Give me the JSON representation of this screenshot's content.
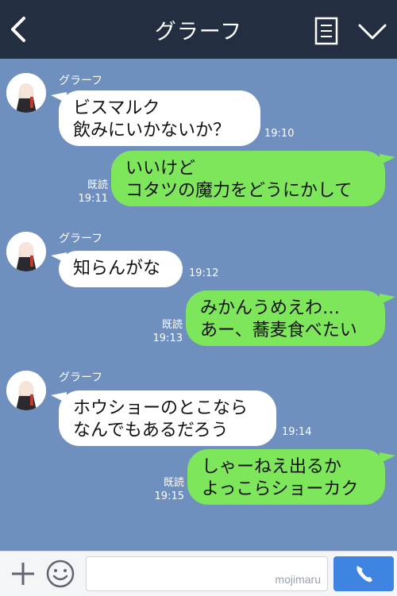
{
  "header": {
    "title": "グラーフ",
    "back_icon": "chevron-left-icon",
    "memo_icon": "note-icon",
    "menu_icon": "chevron-down-icon",
    "background": "#232f40"
  },
  "chat": {
    "background": "#6f8fbf",
    "incoming_bubble_color": "#ffffff",
    "outgoing_bubble_color": "#7ee65a",
    "messages": [
      {
        "direction": "in",
        "sender": "グラーフ",
        "lines": [
          "ビスマルク",
          "飲みにいかないか？"
        ],
        "time": "19:10"
      },
      {
        "direction": "out",
        "lines": [
          "いいけど",
          "コタツの魔力をどうにかして"
        ],
        "read": "既読",
        "time": "19:11"
      },
      {
        "direction": "in",
        "sender": "グラーフ",
        "lines": [
          "知らんがな"
        ],
        "time": "19:12"
      },
      {
        "direction": "out",
        "lines": [
          "みかんうめえわ…",
          "あー、蕎麦食べたい"
        ],
        "read": "既読",
        "time": "19:13"
      },
      {
        "direction": "in",
        "sender": "グラーフ",
        "lines": [
          "ホウショーのとこなら",
          "なんでもあるだろう"
        ],
        "time": "19:14"
      },
      {
        "direction": "out",
        "lines": [
          "しゃーねえ出るか",
          "よっこらショーカク"
        ],
        "read": "既読",
        "time": "19:15"
      }
    ]
  },
  "footer": {
    "input_value": "",
    "watermark": "mojimaru",
    "plus_icon": "plus-icon",
    "emoji_icon": "smiley-icon",
    "call_icon": "phone-icon",
    "call_color": "#3f84e0"
  }
}
